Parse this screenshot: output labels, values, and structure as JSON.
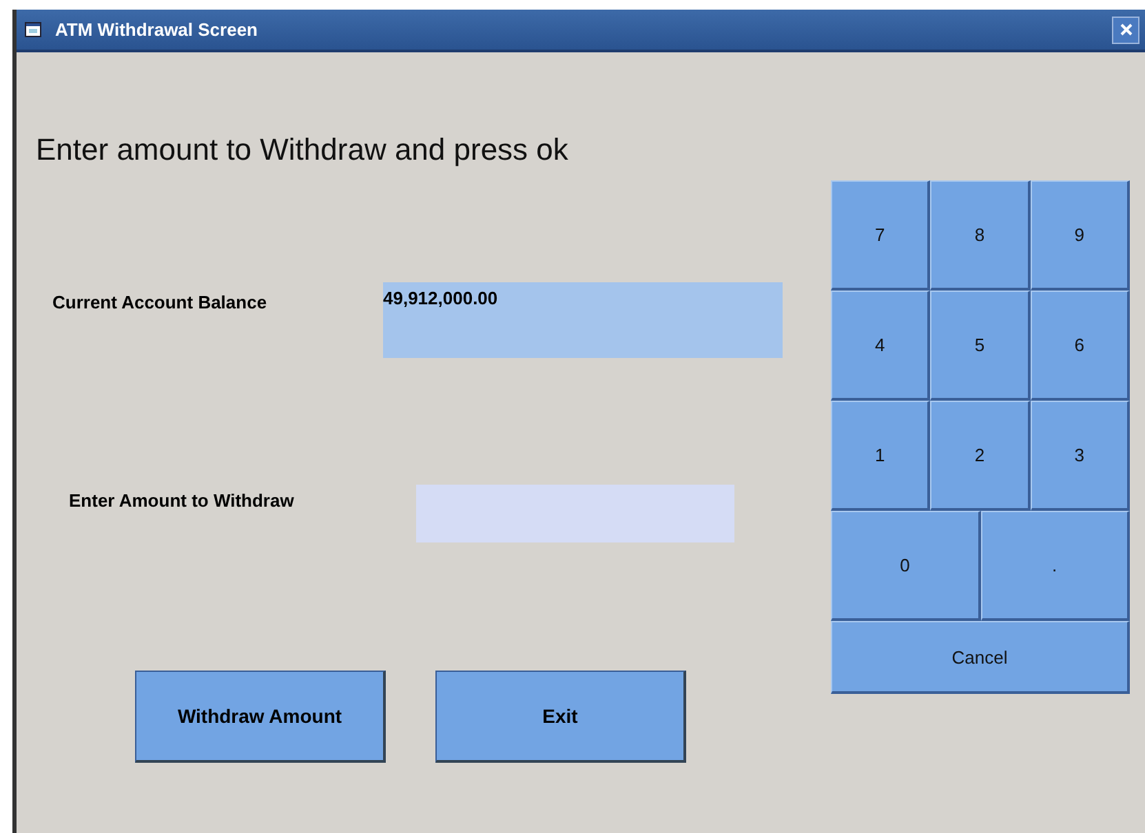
{
  "window": {
    "title": "ATM Withdrawal Screen"
  },
  "instruction": "Enter amount to Withdraw and press ok",
  "balance": {
    "label": "Current Account Balance",
    "value": "49,912,000.00"
  },
  "withdrawal": {
    "label": "Enter Amount to Withdraw"
  },
  "keypad": [
    [
      "7",
      "8",
      "9"
    ],
    [
      "4",
      "5",
      "6"
    ],
    [
      "1",
      "2",
      "3"
    ],
    [
      "0",
      "."
    ],
    [
      "Cancel"
    ]
  ],
  "buttons": [
    "Withdraw Amount",
    "Exit"
  ]
}
